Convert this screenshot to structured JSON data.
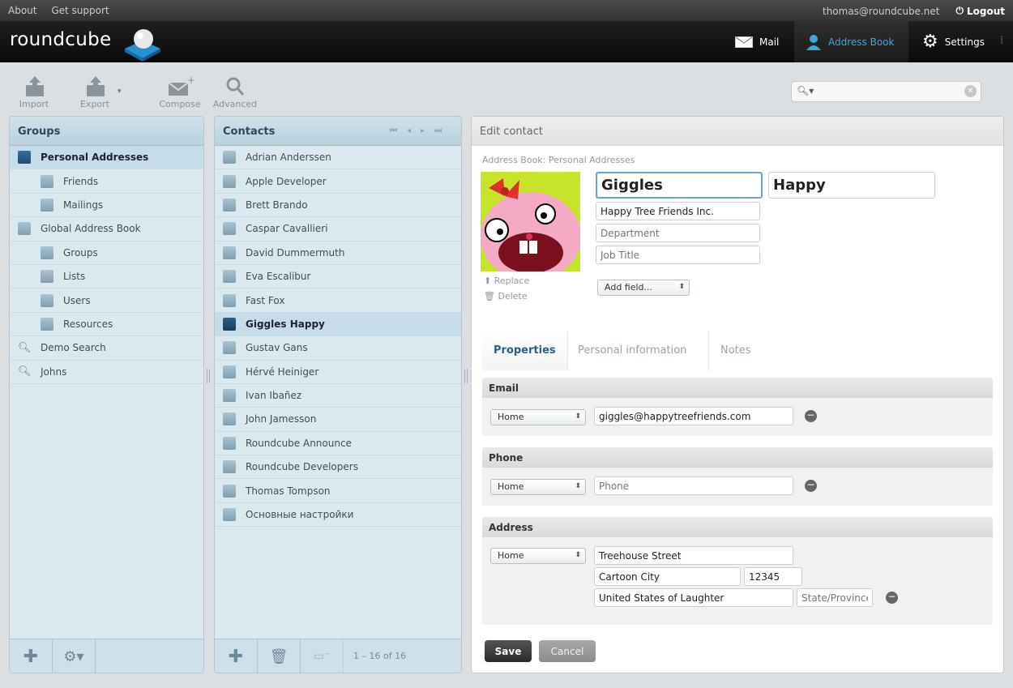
{
  "topbar": {
    "about": "About",
    "support": "Get support",
    "user": "thomas@roundcube.net",
    "logout": "Logout"
  },
  "header": {
    "logo": "roundcube",
    "nav": {
      "mail": "Mail",
      "addressbook": "Address Book",
      "settings": "Settings"
    }
  },
  "toolbar": {
    "import": "Import",
    "export": "Export",
    "compose": "Compose",
    "advanced": "Advanced"
  },
  "groups": {
    "title": "Groups",
    "items": [
      {
        "label": "Personal Addresses",
        "level": 0
      },
      {
        "label": "Friends",
        "level": 1
      },
      {
        "label": "Mailings",
        "level": 1
      },
      {
        "label": "Global Address Book",
        "level": 0
      },
      {
        "label": "Groups",
        "level": 1
      },
      {
        "label": "Lists",
        "level": 1
      },
      {
        "label": "Users",
        "level": 1
      },
      {
        "label": "Resources",
        "level": 1
      },
      {
        "label": "Demo Search",
        "level": 0
      },
      {
        "label": "Johns",
        "level": 0
      }
    ]
  },
  "contacts": {
    "title": "Contacts",
    "items": [
      "Adrian Anderssen",
      "Apple Developer",
      "Brett Brando",
      "Caspar Cavallieri",
      "David Dummermuth",
      "Eva Escalibur",
      "Fast Fox",
      "Giggles Happy",
      "Gustav Gans",
      "Hérvé Heiniger",
      "Ivan Ibañez",
      "John Jamesson",
      "Roundcube Announce",
      "Roundcube Developers",
      "Thomas Tompson",
      "Основные настройки"
    ],
    "selected": "Giggles Happy",
    "count": "1 – 16 of 16"
  },
  "edit": {
    "title": "Edit contact",
    "addressbook": "Address Book: Personal Addresses",
    "firstname": "Giggles",
    "lastname": "Happy",
    "organization": "Happy Tree Friends Inc.",
    "department_ph": "Department",
    "jobtitle_ph": "Job Title",
    "replace": "Replace",
    "delete": "Delete",
    "addfield": "Add field...",
    "tabs": [
      "Properties",
      "Personal information",
      "Notes"
    ],
    "email": {
      "head": "Email",
      "type": "Home",
      "value": "giggles@happytreefriends.com"
    },
    "phone": {
      "head": "Phone",
      "type": "Home",
      "placeholder": "Phone"
    },
    "address": {
      "head": "Address",
      "type": "Home",
      "street": "Treehouse Street",
      "city": "Cartoon City",
      "zip": "12345",
      "country": "United States of Laughter",
      "state_ph": "State/Province"
    },
    "save": "Save",
    "cancel": "Cancel"
  }
}
